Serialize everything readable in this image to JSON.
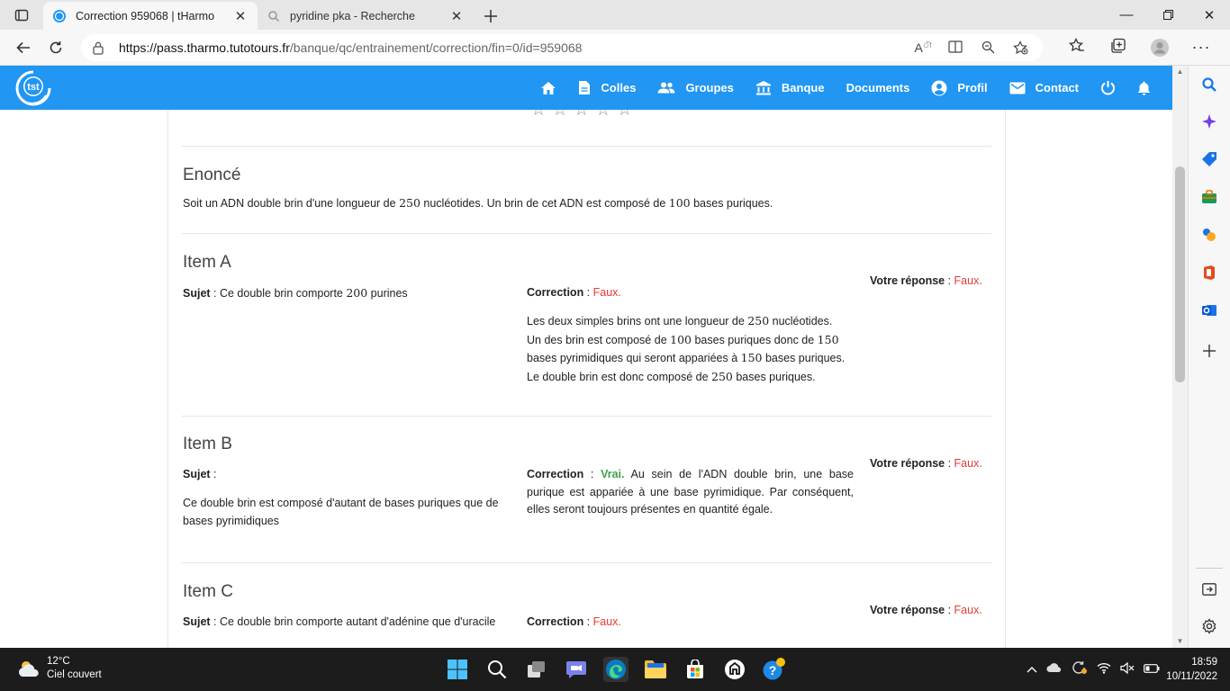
{
  "browser": {
    "tabs": [
      {
        "title": "Correction 959068 | tHarmo",
        "active": true
      },
      {
        "title": "pyridine pka - Recherche",
        "active": false
      }
    ],
    "url_host": "https://pass.tharmo.tutotours.fr",
    "url_path": "/banque/qc/entrainement/correction/fin=0/id=959068"
  },
  "site": {
    "brand_color": "#2196f3",
    "nav": {
      "colles": "Colles",
      "groupes": "Groupes",
      "banque": "Banque",
      "documents": "Documents",
      "profil": "Profil",
      "contact": "Contact"
    }
  },
  "rating": {
    "stars": 5,
    "filled": 0
  },
  "enonce": {
    "title": "Enoncé",
    "text_pre": "Soit un ADN double brin d'une longueur de ",
    "n1": "250",
    "text_mid": " nucléotides. Un brin de cet ADN est composé de ",
    "n2": "100",
    "text_post": " bases puriques."
  },
  "labels": {
    "sujet": "Sujet",
    "correction": "Correction",
    "votre_reponse": "Votre réponse",
    "faux": "Faux.",
    "vrai": "Vrai."
  },
  "items": {
    "a": {
      "title": "Item A",
      "sujet_pre": "Ce double brin comporte ",
      "sujet_num": "200",
      "sujet_post": " purines",
      "expl": [
        [
          "Les deux simples brins ont une longueur de ",
          "250",
          " nucléotides."
        ],
        [
          "Un des brin est composé de ",
          "100",
          " bases puriques donc de ",
          "150"
        ],
        [
          "bases pyrimidiques qui seront appariées à ",
          "150",
          " bases puriques."
        ],
        [
          "Le double brin est donc composé de ",
          "250",
          " bases puriques."
        ]
      ]
    },
    "b": {
      "title": "Item B",
      "sujet": "Ce double brin est composé d'autant de bases puriques que de bases pyrimidiques",
      "correction_text": "Au sein de l'ADN double brin, une base purique est appariée à une base pyrimidique. Par conséquent, elles seront toujours présentes en quantité égale."
    },
    "c": {
      "title": "Item C",
      "sujet": "Ce double brin comporte autant d'adénine que d'uracile"
    }
  },
  "taskbar": {
    "weather_temp": "12°C",
    "weather_desc": "Ciel couvert",
    "time": "18:59",
    "date": "10/11/2022"
  }
}
